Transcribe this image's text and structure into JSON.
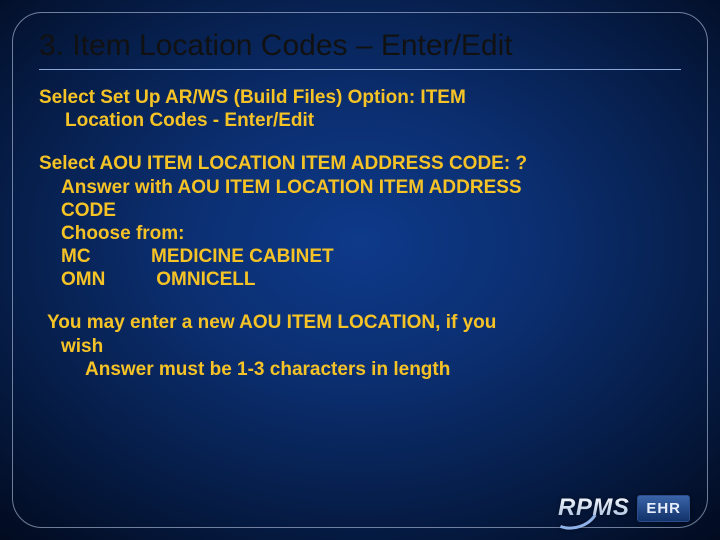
{
  "title": "3. Item Location Codes – Enter/Edit",
  "block1": {
    "line1": "Select Set Up AR/WS (Build Files) Option: ITEM",
    "line2": "Location Codes - Enter/Edit"
  },
  "block2": {
    "prompt": "Select AOU ITEM LOCATION ITEM ADDRESS CODE: ?",
    "answer1": "Answer with AOU ITEM LOCATION ITEM ADDRESS",
    "answer2": "CODE",
    "choose": "Choose from:",
    "codes": [
      {
        "code": "MC",
        "label": "MEDICINE CABINET"
      },
      {
        "code": "OMN",
        "label": " OMNICELL"
      }
    ]
  },
  "block3": {
    "line1": "You may enter a new AOU ITEM LOCATION, if you",
    "line2": "wish",
    "line3": "Answer must be 1-3 characters in length"
  },
  "logo": {
    "rpms": "RPMS",
    "ehr": "EHR"
  }
}
